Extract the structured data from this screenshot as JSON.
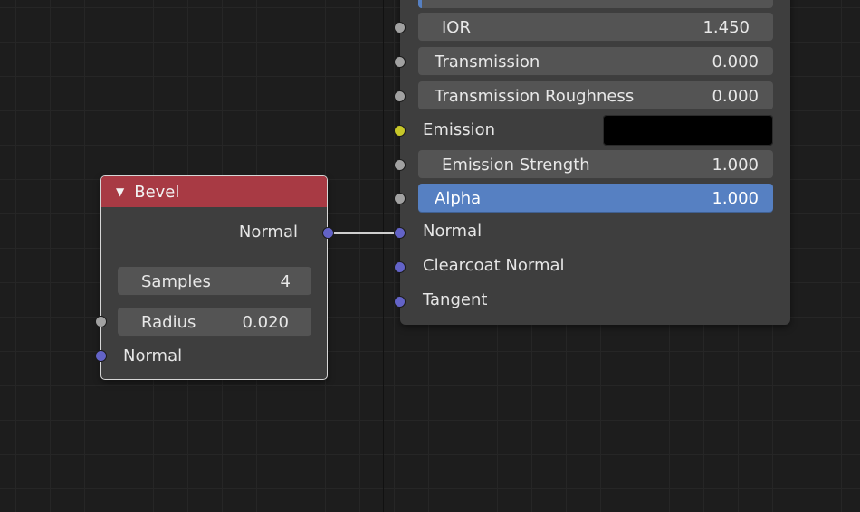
{
  "bevel": {
    "title": "Bevel",
    "output_normal": "Normal",
    "samples_label": "Samples",
    "samples_value": "4",
    "radius_label": "Radius",
    "radius_value": "0.020",
    "input_normal": "Normal"
  },
  "bsdf": {
    "ior_label": "IOR",
    "ior_value": "1.450",
    "transmission_label": "Transmission",
    "transmission_value": "0.000",
    "transmission_roughness_label": "Transmission Roughness",
    "transmission_roughness_value": "0.000",
    "emission_label": "Emission",
    "emission_color": "#000000",
    "emission_strength_label": "Emission Strength",
    "emission_strength_value": "1.000",
    "alpha_label": "Alpha",
    "alpha_value": "1.000",
    "normal_label": "Normal",
    "clearcoat_normal_label": "Clearcoat Normal",
    "tangent_label": "Tangent"
  },
  "colors": {
    "bevel_header": "#a83a44",
    "socket_gray": "#a1a1a1",
    "socket_blue": "#6363c7",
    "socket_yellow": "#c7c729",
    "alpha_highlight": "#5680c2"
  }
}
